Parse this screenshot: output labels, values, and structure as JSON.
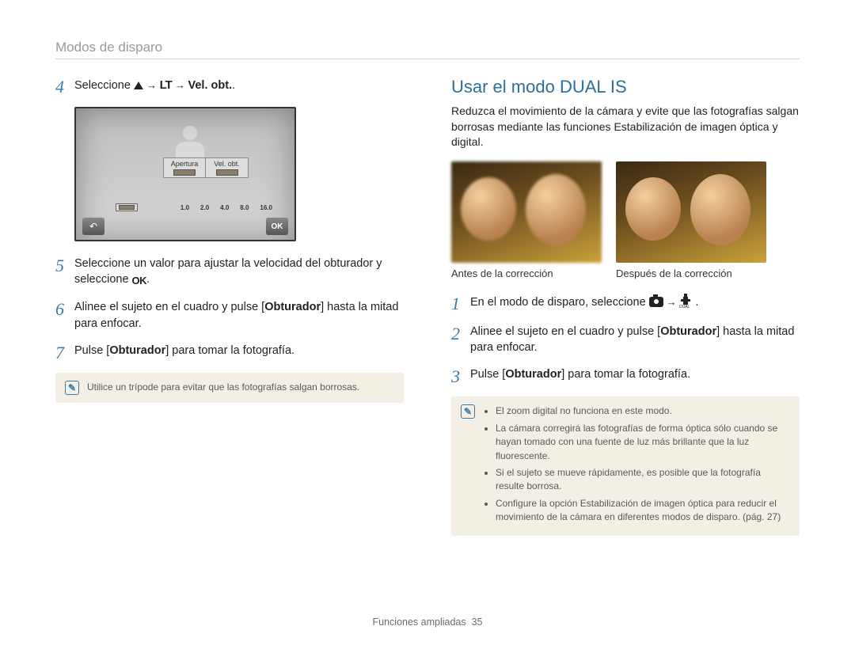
{
  "header": "Modos de disparo",
  "left": {
    "step4": {
      "num": "4",
      "pre": "Seleccione ",
      "mid1": " → ",
      "lt": "LT",
      "mid2": " → ",
      "bold_suffix": "Vel. obt."
    },
    "screen": {
      "tab_left": "Apertura",
      "tab_right": "Vel. obt.",
      "ticks": [
        "1.0",
        "2.0",
        "4.0",
        "8.0",
        "16.0"
      ],
      "ok": "OK"
    },
    "step5": {
      "num": "5",
      "text_a": "Seleccione un valor para ajustar la velocidad del obturador y seleccione ",
      "ok": "OK",
      "text_b": "."
    },
    "step6": {
      "num": "6",
      "text_a": "Alinee el sujeto en el cuadro y pulse [",
      "bold": "Obturador",
      "text_b": "] hasta la mitad para enfocar."
    },
    "step7": {
      "num": "7",
      "text_a": "Pulse [",
      "bold": "Obturador",
      "text_b": "] para tomar la fotografía."
    },
    "tip": "Utilice un trípode para evitar que las fotografías salgan borrosas."
  },
  "right": {
    "title": "Usar el modo DUAL IS",
    "intro": "Reduzca el movimiento de la cámara y evite que las fotografías salgan borrosas mediante las funciones Estabilización de imagen óptica y digital.",
    "caption_before": "Antes de la corrección",
    "caption_after": "Después de la corrección",
    "step1": {
      "num": "1",
      "text": "En el modo de disparo, seleccione ",
      "mid": " → ",
      "end": "."
    },
    "step2": {
      "num": "2",
      "text_a": "Alinee el sujeto en el cuadro y pulse [",
      "bold": "Obturador",
      "text_b": "] hasta la mitad para enfocar."
    },
    "step3": {
      "num": "3",
      "text_a": "Pulse [",
      "bold": "Obturador",
      "text_b": "] para tomar la fotografía."
    },
    "tips": [
      "El zoom digital no funciona en este modo.",
      "La cámara corregirá las fotografías de forma óptica sólo cuando se hayan tomado con una fuente de luz más brillante que la luz fluorescente.",
      "Si el sujeto se mueve rápidamente, es posible que la fotografía resulte borrosa.",
      "Configure la opción Estabilización de imagen óptica para reducir el movimiento de la cámara en diferentes modos de disparo. (pág. 27)"
    ]
  },
  "footer": {
    "label": "Funciones ampliadas",
    "page": "35"
  }
}
